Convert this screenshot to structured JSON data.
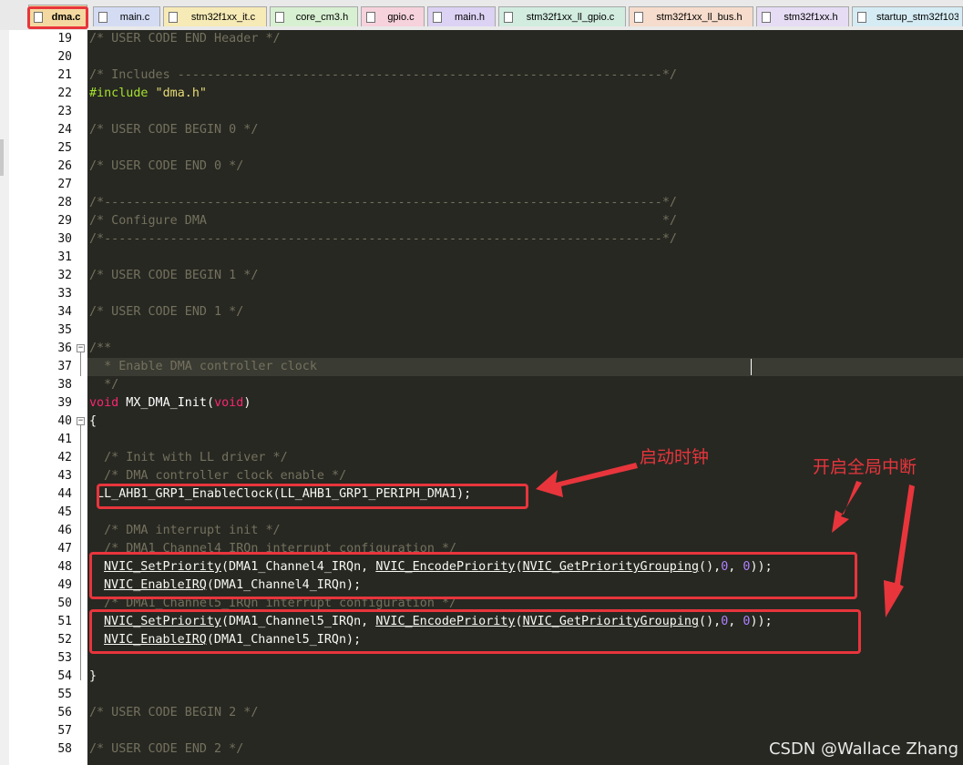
{
  "tabs": [
    {
      "label": "dma.c",
      "color": "#f3d9a0",
      "active": true
    },
    {
      "label": "main.c",
      "color": "#d4dcf4"
    },
    {
      "label": "stm32f1xx_it.c",
      "color": "#f6eab6"
    },
    {
      "label": "core_cm3.h",
      "color": "#d8f0d2"
    },
    {
      "label": "gpio.c",
      "color": "#f6d2dc"
    },
    {
      "label": "main.h",
      "color": "#dcd2f4"
    },
    {
      "label": "stm32f1xx_ll_gpio.c",
      "color": "#d2ece0"
    },
    {
      "label": "stm32f1xx_ll_bus.h",
      "color": "#f6dccc"
    },
    {
      "label": "stm32f1xx.h",
      "color": "#e6dcf4"
    },
    {
      "label": "startup_stm32f103",
      "color": "#d6ecf4"
    }
  ],
  "line_numbers": [
    "19",
    "20",
    "21",
    "22",
    "23",
    "24",
    "25",
    "26",
    "27",
    "28",
    "29",
    "30",
    "31",
    "32",
    "33",
    "34",
    "35",
    "36",
    "37",
    "38",
    "39",
    "40",
    "41",
    "42",
    "43",
    "44",
    "45",
    "46",
    "47",
    "48",
    "49",
    "50",
    "51",
    "52",
    "53",
    "54",
    "55",
    "56",
    "57",
    "58"
  ],
  "code": {
    "l19": "/* USER CODE END Header */",
    "l21": "/* Includes ------------------------------------------------------------------*/",
    "l22_directive": "#include",
    "l22_file": " \"dma.h\"",
    "l24": "/* USER CODE BEGIN 0 */",
    "l26": "/* USER CODE END 0 */",
    "l28": "/*----------------------------------------------------------------------------*/",
    "l29": "/* Configure DMA                                                              */",
    "l30": "/*----------------------------------------------------------------------------*/",
    "l32": "/* USER CODE BEGIN 1 */",
    "l34": "/* USER CODE END 1 */",
    "l36": "/**",
    "l37": "  * Enable DMA controller clock",
    "l38": "  */",
    "l39_kw": "void",
    "l39_fn": " MX_DMA_Init",
    "l39_p1": "(",
    "l39_arg": "void",
    "l39_p2": ")",
    "l40": "{",
    "l42": "  /* Init with LL driver */",
    "l43": "  /* DMA controller clock enable */",
    "l44": " LL_AHB1_GRP1_EnableClock(LL_AHB1_GRP1_PERIPH_DMA1);",
    "l46": "  /* DMA interrupt init */",
    "l47": "  /* DMA1_Channel4_IRQn interrupt configuration */",
    "l48_a": "NVIC_SetPriority",
    "l48_b": "(DMA1_Channel4_IRQn, ",
    "l48_c": "NVIC_EncodePriority",
    "l48_d": "(",
    "l48_e": "NVIC_GetPriorityGrouping",
    "l48_f": "(),",
    "l48_g": "0",
    "l48_h": ", ",
    "l48_i": "0",
    "l48_j": "));",
    "l49_a": "NVIC_EnableIRQ",
    "l49_b": "(DMA1_Channel4_IRQn);",
    "l50": "  /* DMA1_Channel5_IRQn interrupt configuration */",
    "l51_a": "NVIC_SetPriority",
    "l51_b": "(DMA1_Channel5_IRQn, ",
    "l51_c": "NVIC_EncodePriority",
    "l51_d": "(",
    "l51_e": "NVIC_GetPriorityGrouping",
    "l51_f": "(),",
    "l51_g": "0",
    "l51_h": ", ",
    "l51_i": "0",
    "l51_j": "));",
    "l52_a": "NVIC_EnableIRQ",
    "l52_b": "(DMA1_Channel5_IRQn);",
    "l54": "}",
    "l56": "/* USER CODE BEGIN 2 */",
    "l58": "/* USER CODE END 2 */"
  },
  "annotations": {
    "clock": "启动时钟",
    "interrupt": "开启全局中断"
  },
  "watermark": "CSDN @Wallace Zhang",
  "colors": {
    "editor_bg": "#272822",
    "comment": "#75715e",
    "keyword": "#f92672",
    "preprocessor": "#a6e22e",
    "string": "#e6db74",
    "number": "#ae81ff",
    "annotation_red": "#e8353c"
  }
}
